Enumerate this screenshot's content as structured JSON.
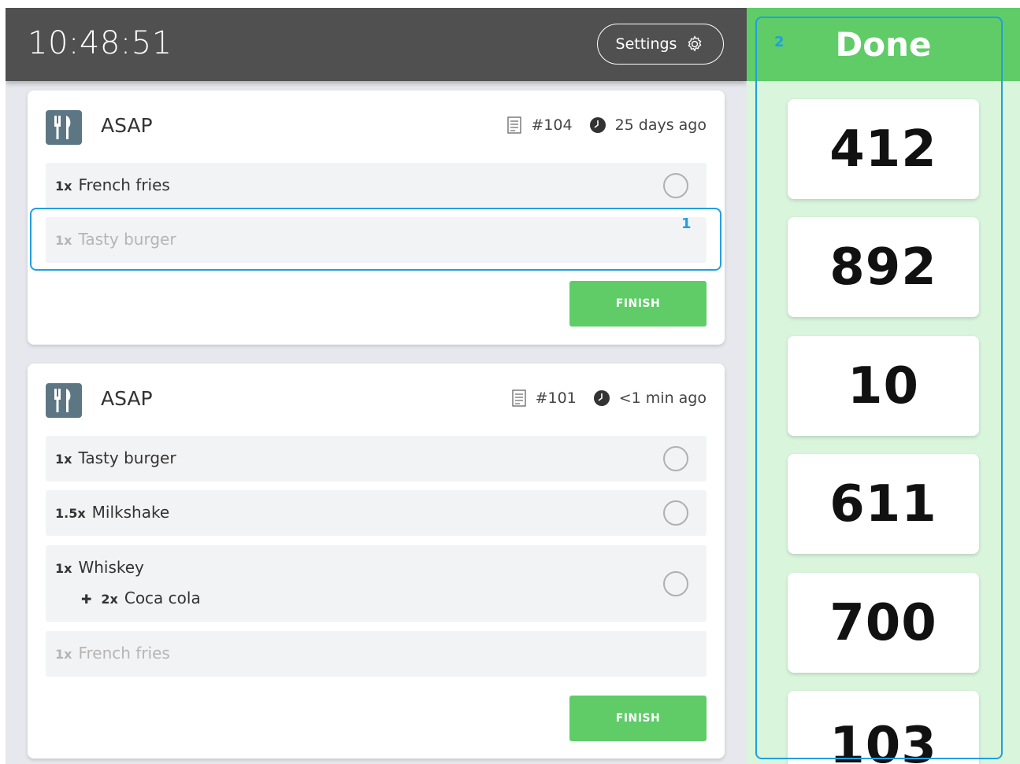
{
  "header": {
    "clock": "10:48:51",
    "settings_label": "Settings"
  },
  "orders": [
    {
      "type": "ASAP",
      "number": "#104",
      "time": "25 days ago",
      "items": [
        {
          "qty": "1x",
          "name": "French fries",
          "done": false
        },
        {
          "qty": "1x",
          "name": "Tasty burger",
          "done": true
        }
      ],
      "finish_label": "FINISH"
    },
    {
      "type": "ASAP",
      "number": "#101",
      "time": "<1 min ago",
      "items": [
        {
          "qty": "1x",
          "name": "Tasty burger",
          "done": false
        },
        {
          "qty": "1.5x",
          "name": "Milkshake",
          "done": false
        },
        {
          "qty": "1x",
          "name": "Whiskey",
          "done": false,
          "extra": {
            "qty": "2x",
            "name": "Coca cola"
          }
        },
        {
          "qty": "1x",
          "name": "French fries",
          "done": true
        }
      ],
      "finish_label": "FINISH"
    }
  ],
  "done_panel": {
    "title": "Done",
    "tickets": [
      "412",
      "892",
      "10",
      "611",
      "700",
      "103"
    ]
  },
  "annotations": [
    "1",
    "2"
  ],
  "colors": {
    "header_bg": "#505050",
    "accent_green": "#5fcc68",
    "done_panel_bg": "#d9f5dc",
    "highlight": "#1ea0e0",
    "icon_badge": "#5d7684"
  }
}
